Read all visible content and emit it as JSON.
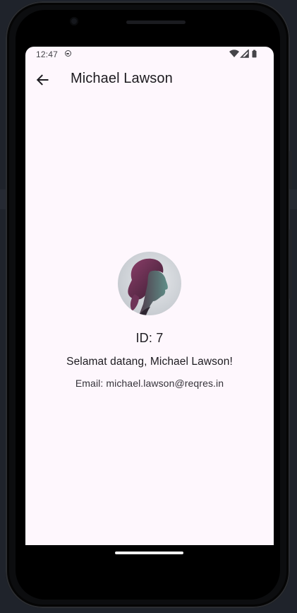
{
  "status_bar": {
    "time": "12:47",
    "icons": [
      "notification-badge-icon",
      "wifi-icon",
      "signal-icon",
      "battery-icon"
    ]
  },
  "app_bar": {
    "title": "Michael Lawson",
    "back_icon": "arrow-back-icon"
  },
  "profile": {
    "avatar_description": "circular user portrait",
    "id_text": "ID: 7",
    "welcome_text": "Selamat datang, Michael Lawson!",
    "email_text": "Email: michael.lawson@reqres.in"
  },
  "colors": {
    "screen_background": "#fef7fd",
    "text_primary": "#1d1b20",
    "text_secondary": "#35333a",
    "phone_body": "#0c0d0f",
    "backdrop": "#1f232b"
  }
}
